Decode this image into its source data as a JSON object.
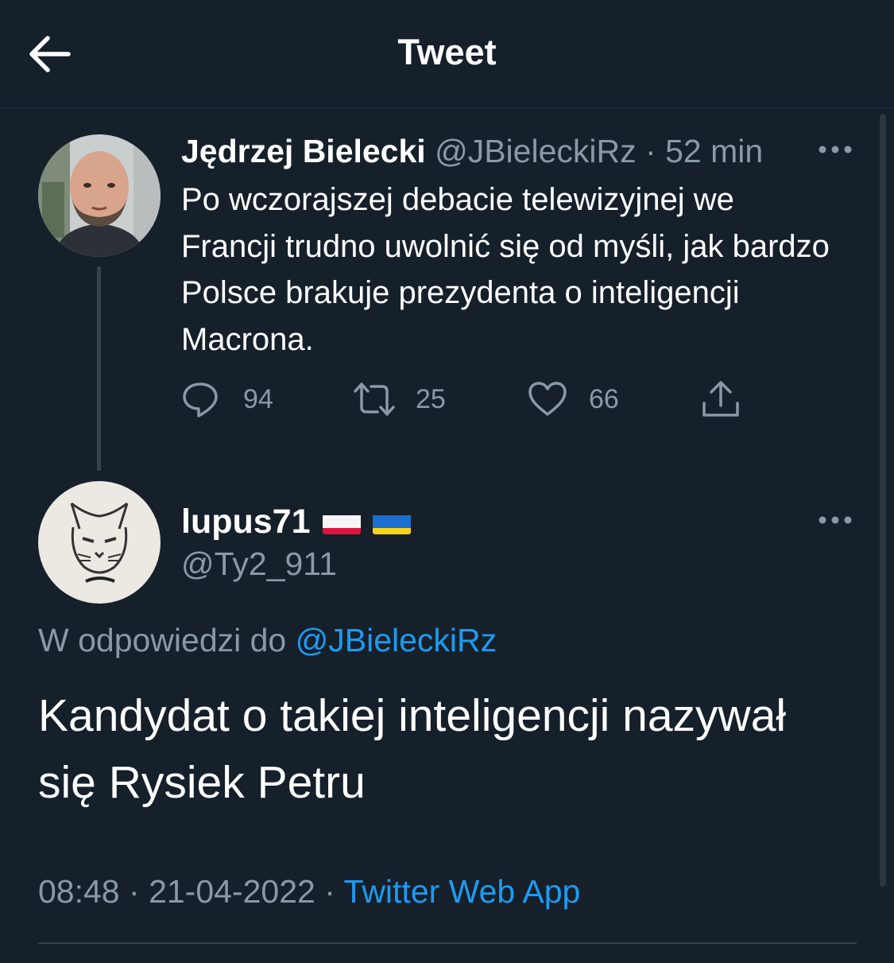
{
  "header": {
    "title": "Tweet"
  },
  "original_tweet": {
    "author_name": "Jędrzej Bielecki",
    "author_handle": "@JBieleckiRz",
    "separator": "·",
    "time_ago": "52 min",
    "text": "Po wczorajszej debacie telewizyjnej we Francji trudno uwolnić się od myśli, jak bardzo Polsce brakuje prezydenta o inteligencji Macrona.",
    "reply_count": "94",
    "retweet_count": "25",
    "like_count": "66"
  },
  "reply_tweet": {
    "author_name": "lupus71",
    "author_handle": "@Ty2_911",
    "replying_to_label": "W odpowiedzi do",
    "replying_to_handle": "@JBieleckiRz",
    "text": "Kandydat o takiej inteligencji nazywał się Rysiek Petru",
    "time": "08:48",
    "date": "21-04-2022",
    "separator": "·",
    "source": "Twitter Web App",
    "flags": [
      "flag-poland-icon",
      "flag-ukraine-icon"
    ]
  },
  "colors": {
    "background": "#15202b",
    "text_primary": "#ffffff",
    "text_secondary": "#8b98a5",
    "link": "#1d9bf0",
    "border": "#38444d"
  }
}
